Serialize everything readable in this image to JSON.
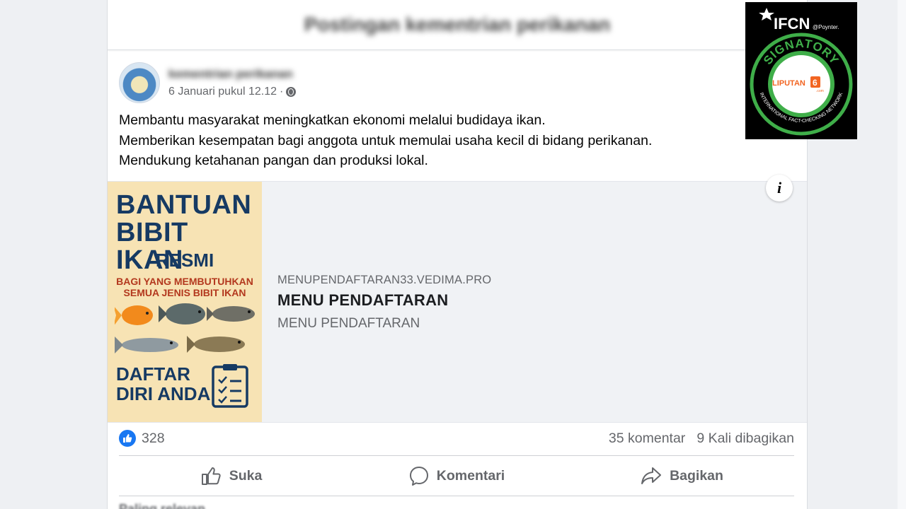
{
  "page_header": {
    "title": "Postingan kementrian perikanan"
  },
  "post": {
    "page_name": "kementrian perikanan",
    "timestamp": "6 Januari pukul 12.12",
    "separator": "·",
    "privacy_icon": "globe-icon",
    "lines": [
      "Membantu masyarakat meningkatkan ekonomi melalui budidaya ikan.",
      "Memberikan kesempatan bagi anggota untuk memulai usaha kecil di bidang perikanan.",
      "Mendukung ketahanan pangan dan produksi lokal."
    ]
  },
  "ad_image": {
    "title_line1": "BANTUAN",
    "title_line2": "BIBIT IKAN",
    "resmi": "RESMI",
    "sub_line1": "BAGI YANG MEMBUTUHKAN",
    "sub_line2": "SEMUA JENIS BIBIT IKAN",
    "cta_line1": "DAFTAR",
    "cta_line2": "DIRI ANDA"
  },
  "link": {
    "domain": "MENUPENDAFTARAN33.VEDIMA.PRO",
    "title": "MENU PENDAFTARAN",
    "description": "MENU PENDAFTARAN",
    "info_label": "i"
  },
  "stats": {
    "likes": "328",
    "comments": "35 komentar",
    "shares": "9 Kali dibagikan"
  },
  "actions": {
    "like": "Suka",
    "comment": "Komentari",
    "share": "Bagikan"
  },
  "comments_sort": "Paling relevan",
  "badge": {
    "ifcn": "IFCN",
    "poynter": "@Poynter.",
    "signatory": "SIGNATORY",
    "network": "INTERNATIONAL FACT-CHECKING NETWORK",
    "liputan": "LIPUTAN",
    "liputan_num": "6",
    "liputan_dom": ".com",
    "green": "#3fae49",
    "orange": "#f26522"
  }
}
